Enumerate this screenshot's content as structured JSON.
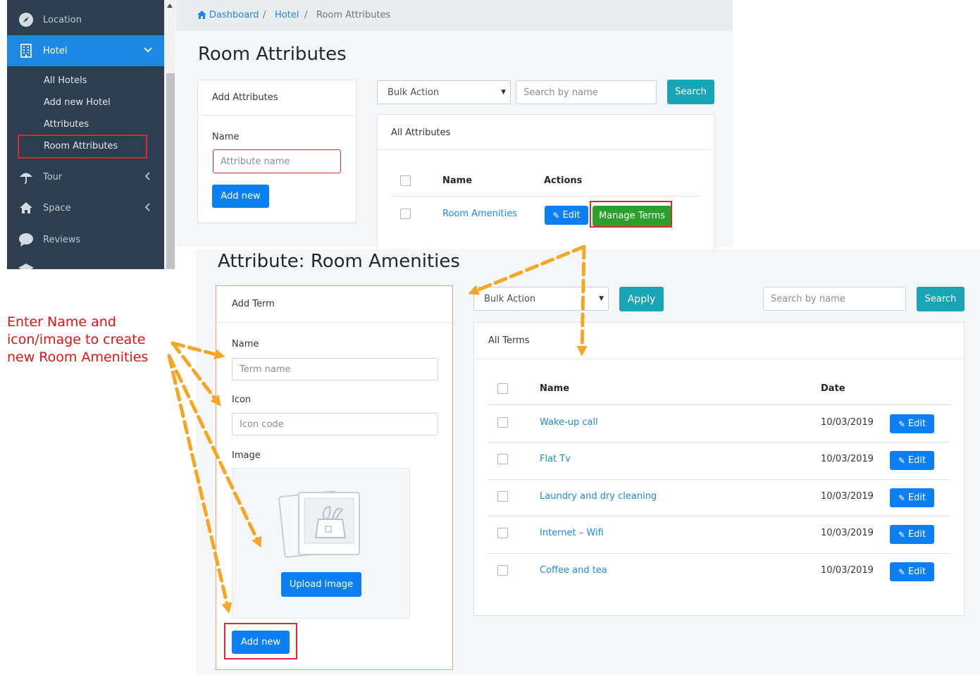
{
  "sidebar": {
    "items": [
      {
        "label": "Location",
        "icon": "compass-icon"
      },
      {
        "label": "Hotel",
        "icon": "building-icon",
        "active": true
      },
      {
        "label": "Tour",
        "icon": "umbrella-icon"
      },
      {
        "label": "Space",
        "icon": "home-icon"
      },
      {
        "label": "Reviews",
        "icon": "comment-icon"
      }
    ],
    "sub_items": [
      "All Hotels",
      "Add new Hotel",
      "Attributes",
      "Room Attributes"
    ]
  },
  "breadcrumb": {
    "home": "Dashboard",
    "parent": "Hotel",
    "current": "Room Attributes",
    "separator": "/"
  },
  "top": {
    "title": "Room Attributes",
    "add_card": {
      "header": "Add Attributes",
      "name_label": "Name",
      "name_placeholder": "Attribute name",
      "add_button": "Add new"
    },
    "bulk_action": "Bulk Action",
    "search_placeholder": "Search by name",
    "search_button": "Search",
    "list_card": {
      "header": "All Attributes",
      "col_name": "Name",
      "col_actions": "Actions",
      "rows": [
        {
          "name": "Room Amenities",
          "edit": "Edit",
          "manage": "Manage Terms"
        }
      ]
    }
  },
  "bottom": {
    "title": "Attribute: Room Amenities",
    "add_card": {
      "header": "Add Term",
      "name_label": "Name",
      "name_placeholder": "Term name",
      "icon_label": "Icon",
      "icon_placeholder": "Icon code",
      "image_label": "Image",
      "upload_button": "Upload image",
      "add_button": "Add new"
    },
    "bulk_action": "Bulk Action",
    "apply_button": "Apply",
    "search_placeholder": "Search by name",
    "search_button": "Search",
    "list_card": {
      "header": "All Terms",
      "col_name": "Name",
      "col_date": "Date",
      "edit_label": "Edit",
      "rows": [
        {
          "name": "Wake-up call",
          "date": "10/03/2019"
        },
        {
          "name": "Flat Tv",
          "date": "10/03/2019"
        },
        {
          "name": "Laundry and dry cleaning",
          "date": "10/03/2019"
        },
        {
          "name": "Internet – Wifi",
          "date": "10/03/2019"
        },
        {
          "name": "Coffee and tea",
          "date": "10/03/2019"
        }
      ]
    }
  },
  "annotation": {
    "text": "Enter Name and icon/image to create new Room Amenities"
  },
  "colors": {
    "sidebar_bg": "#2c3e50",
    "active": "#1e88e5",
    "primary": "#0d7ff5",
    "teal": "#1aa5b7",
    "green": "#2ca02c",
    "highlight_red": "#e32636",
    "arrow_orange": "#f5a623",
    "annotation_red": "#e3140f"
  }
}
